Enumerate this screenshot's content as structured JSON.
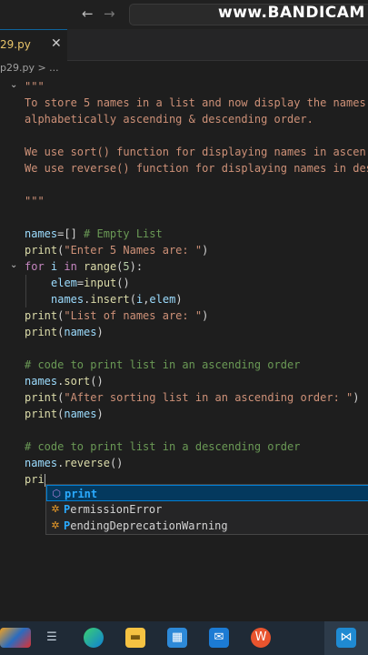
{
  "browser": {
    "watermark": "www.BANDICAM",
    "back_icon": "arrow-left-icon",
    "forward_icon": "arrow-right-icon"
  },
  "tab": {
    "label": "29.py",
    "close": "✕"
  },
  "breadcrumb": "p29.py > ...",
  "code": {
    "l1": "\"\"\"",
    "l2": "To store 5 names in a list and now display the names",
    "l3": "alphabetically ascending & descending order.",
    "l4": "We use sort() function for displaying names in ascen",
    "l5": "We use reverse() function for displaying names in des",
    "l6": "\"\"\"",
    "l7_a": "names",
    "l7_b": "=[] ",
    "l7_c": "# Empty List",
    "l8_a": "print",
    "l8_b": "(",
    "l8_c": "\"Enter 5 Names are: \"",
    "l8_d": ")",
    "l9_a": "for ",
    "l9_b": "i",
    "l9_c": " in ",
    "l9_d": "range",
    "l9_e": "(",
    "l9_f": "5",
    "l9_g": "):",
    "l10_a": "elem",
    "l10_b": "=",
    "l10_c": "input",
    "l10_d": "()",
    "l11_a": "names",
    "l11_b": ".",
    "l11_c": "insert",
    "l11_d": "(",
    "l11_e": "i",
    "l11_f": ",",
    "l11_g": "elem",
    "l11_h": ")",
    "l12_a": "print",
    "l12_b": "(",
    "l12_c": "\"List of names are: \"",
    "l12_d": ")",
    "l13_a": "print",
    "l13_b": "(",
    "l13_c": "names",
    "l13_d": ")",
    "l14": "# code to print list in an ascending order",
    "l15_a": "names",
    "l15_b": ".",
    "l15_c": "sort",
    "l15_d": "()",
    "l16_a": "print",
    "l16_b": "(",
    "l16_c": "\"After sorting list in an ascending order: \"",
    "l16_d": ")",
    "l17_a": "print",
    "l17_b": "(",
    "l17_c": "names",
    "l17_d": ")",
    "l18": "# code to print list in a descending order",
    "l19_a": "names",
    "l19_b": ".",
    "l19_c": "reverse",
    "l19_d": "()",
    "l20": "pri"
  },
  "suggestions": [
    {
      "match": "print",
      "rest": "",
      "icon": "cube-icon"
    },
    {
      "match": "P",
      "rest": "ermissionError",
      "icon": "class-icon"
    },
    {
      "match": "P",
      "rest": "endingDeprecationWarning",
      "icon": "class-icon"
    }
  ],
  "colors": {
    "keyword": "#c586c0",
    "function": "#dcdcaa",
    "string": "#ce9178",
    "comment": "#6a9955",
    "variable": "#9cdcfe",
    "selection": "#04395e"
  }
}
